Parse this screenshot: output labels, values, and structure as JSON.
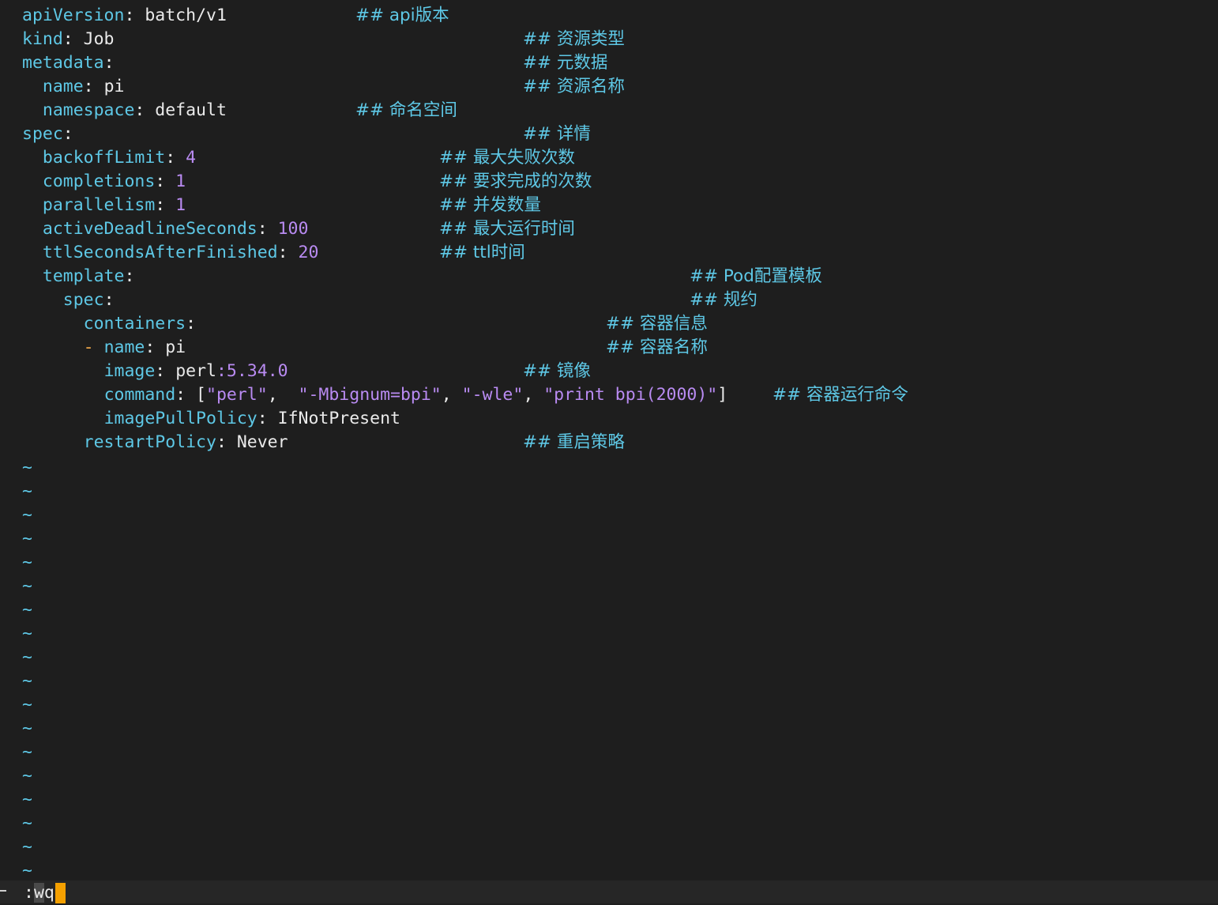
{
  "editor": {
    "lines": [
      {
        "indent": "",
        "key": "apiVersion",
        "value": "batch/v1",
        "comment": "## api版本"
      },
      {
        "indent": "",
        "key": "kind",
        "value": "Job",
        "comment": "## 资源类型"
      },
      {
        "indent": "",
        "key": "metadata",
        "value": "",
        "comment": "## 元数据"
      },
      {
        "indent": "  ",
        "key": "name",
        "value": "pi",
        "comment": "## 资源名称"
      },
      {
        "indent": "  ",
        "key": "namespace",
        "value": "default",
        "comment": "## 命名空间"
      },
      {
        "indent": "",
        "key": "spec",
        "value": "",
        "comment": "## 详情"
      },
      {
        "indent": "  ",
        "key": "backoffLimit",
        "value": "4",
        "comment": "## 最大失败次数"
      },
      {
        "indent": "  ",
        "key": "completions",
        "value": "1",
        "comment": "## 要求完成的次数"
      },
      {
        "indent": "  ",
        "key": "parallelism",
        "value": "1",
        "comment": "## 并发数量"
      },
      {
        "indent": "  ",
        "key": "activeDeadlineSeconds",
        "value": "100",
        "comment": "## 最大运行时间"
      },
      {
        "indent": "  ",
        "key": "ttlSecondsAfterFinished",
        "value": "20",
        "comment": "## ttl时间"
      },
      {
        "indent": "  ",
        "key": "template",
        "value": "",
        "comment": "## Pod配置模板"
      },
      {
        "indent": "    ",
        "key": "spec",
        "value": "",
        "comment": "## 规约"
      },
      {
        "indent": "      ",
        "key": "containers",
        "value": "",
        "comment": "## 容器信息"
      },
      {
        "indent": "      ",
        "dash": "- ",
        "key": "name",
        "value": "pi",
        "comment": "## 容器名称"
      },
      {
        "indent": "        ",
        "key": "image",
        "value_a": "perl",
        "value_b": ":5.34.0",
        "comment": "## 镜像"
      },
      {
        "indent": "        ",
        "key": "command",
        "array": [
          "\"perl\"",
          "\"-Mbignum=bpi\"",
          "\"-wle\"",
          "\"print bpi(2000)\""
        ],
        "comment": "## 容器运行命令"
      },
      {
        "indent": "        ",
        "key": "imagePullPolicy",
        "value": "IfNotPresent",
        "comment": ""
      },
      {
        "indent": "      ",
        "key": "restartPolicy",
        "value": "Never",
        "comment": "## 重启策略"
      }
    ],
    "empty_line_marker": "~",
    "empty_line_count": 18
  },
  "statusbar": {
    "command_colon": ":",
    "command_w": "w",
    "command_q": "q"
  },
  "colors": {
    "background": "#1e1e1e",
    "key": "#5ec8e6",
    "number_string": "#b98bf2",
    "cursor": "#f5a000"
  }
}
